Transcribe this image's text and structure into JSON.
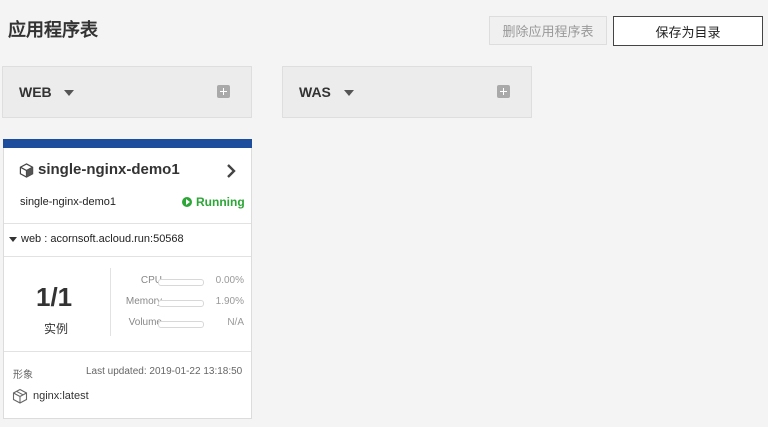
{
  "header": {
    "title": "应用程序表",
    "delete_label": "删除应用程序表",
    "save_label": "保存为目录"
  },
  "groups": [
    {
      "name": "WEB",
      "icons": [
        "chevron-down-icon",
        "plus-square-icon"
      ]
    },
    {
      "name": "WAS",
      "icons": [
        "chevron-down-icon",
        "plus-square-icon"
      ]
    }
  ],
  "card": {
    "accent_color": "#1d4e9e",
    "title": "single-nginx-demo1",
    "subname": "single-nginx-demo1",
    "status": "Running",
    "status_color": "#2ca636",
    "route": "web : acornsoft.acloud.run:50568",
    "instances": "1/1",
    "instances_label": "实例",
    "metrics": [
      {
        "label": "CPU",
        "value": "0.00%",
        "fraction": 0.0
      },
      {
        "label": "Memory",
        "value": "1.90%",
        "fraction": 0.019
      },
      {
        "label": "Volume",
        "value": "N/A",
        "fraction": 0.0
      }
    ],
    "image_heading": "形象",
    "last_updated": "Last updated: 2019-01-22 13:18:50",
    "image": "nginx:latest"
  }
}
